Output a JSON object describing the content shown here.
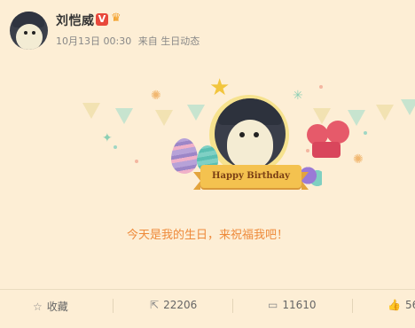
{
  "post": {
    "username": "刘恺威",
    "verified_badge": "V",
    "time": "10月13日 00:30",
    "source": "来自 生日动态",
    "banner_text": "Happy Birthday",
    "message": "今天是我的生日，来祝福我吧！"
  },
  "actions": {
    "favorite_label": "收藏",
    "repost_count": "22206",
    "comment_count": "11610",
    "like_count": "56"
  },
  "icons": {
    "favorite": "star-icon",
    "repost": "share-icon",
    "comment": "comment-icon",
    "like": "thumbs-up-icon"
  },
  "colors": {
    "background": "#fdeed5",
    "message": "#ee8a3a",
    "badge": "#e8483b"
  }
}
